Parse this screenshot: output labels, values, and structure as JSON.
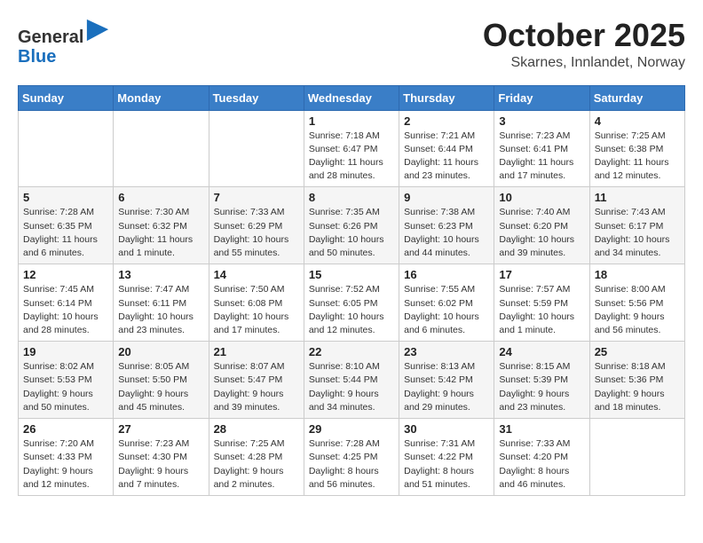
{
  "header": {
    "logo_line1": "General",
    "logo_line2": "Blue",
    "month": "October 2025",
    "location": "Skarnes, Innlandet, Norway"
  },
  "weekdays": [
    "Sunday",
    "Monday",
    "Tuesday",
    "Wednesday",
    "Thursday",
    "Friday",
    "Saturday"
  ],
  "weeks": [
    [
      {
        "day": "",
        "detail": ""
      },
      {
        "day": "",
        "detail": ""
      },
      {
        "day": "",
        "detail": ""
      },
      {
        "day": "1",
        "detail": "Sunrise: 7:18 AM\nSunset: 6:47 PM\nDaylight: 11 hours\nand 28 minutes."
      },
      {
        "day": "2",
        "detail": "Sunrise: 7:21 AM\nSunset: 6:44 PM\nDaylight: 11 hours\nand 23 minutes."
      },
      {
        "day": "3",
        "detail": "Sunrise: 7:23 AM\nSunset: 6:41 PM\nDaylight: 11 hours\nand 17 minutes."
      },
      {
        "day": "4",
        "detail": "Sunrise: 7:25 AM\nSunset: 6:38 PM\nDaylight: 11 hours\nand 12 minutes."
      }
    ],
    [
      {
        "day": "5",
        "detail": "Sunrise: 7:28 AM\nSunset: 6:35 PM\nDaylight: 11 hours\nand 6 minutes."
      },
      {
        "day": "6",
        "detail": "Sunrise: 7:30 AM\nSunset: 6:32 PM\nDaylight: 11 hours\nand 1 minute."
      },
      {
        "day": "7",
        "detail": "Sunrise: 7:33 AM\nSunset: 6:29 PM\nDaylight: 10 hours\nand 55 minutes."
      },
      {
        "day": "8",
        "detail": "Sunrise: 7:35 AM\nSunset: 6:26 PM\nDaylight: 10 hours\nand 50 minutes."
      },
      {
        "day": "9",
        "detail": "Sunrise: 7:38 AM\nSunset: 6:23 PM\nDaylight: 10 hours\nand 44 minutes."
      },
      {
        "day": "10",
        "detail": "Sunrise: 7:40 AM\nSunset: 6:20 PM\nDaylight: 10 hours\nand 39 minutes."
      },
      {
        "day": "11",
        "detail": "Sunrise: 7:43 AM\nSunset: 6:17 PM\nDaylight: 10 hours\nand 34 minutes."
      }
    ],
    [
      {
        "day": "12",
        "detail": "Sunrise: 7:45 AM\nSunset: 6:14 PM\nDaylight: 10 hours\nand 28 minutes."
      },
      {
        "day": "13",
        "detail": "Sunrise: 7:47 AM\nSunset: 6:11 PM\nDaylight: 10 hours\nand 23 minutes."
      },
      {
        "day": "14",
        "detail": "Sunrise: 7:50 AM\nSunset: 6:08 PM\nDaylight: 10 hours\nand 17 minutes."
      },
      {
        "day": "15",
        "detail": "Sunrise: 7:52 AM\nSunset: 6:05 PM\nDaylight: 10 hours\nand 12 minutes."
      },
      {
        "day": "16",
        "detail": "Sunrise: 7:55 AM\nSunset: 6:02 PM\nDaylight: 10 hours\nand 6 minutes."
      },
      {
        "day": "17",
        "detail": "Sunrise: 7:57 AM\nSunset: 5:59 PM\nDaylight: 10 hours\nand 1 minute."
      },
      {
        "day": "18",
        "detail": "Sunrise: 8:00 AM\nSunset: 5:56 PM\nDaylight: 9 hours\nand 56 minutes."
      }
    ],
    [
      {
        "day": "19",
        "detail": "Sunrise: 8:02 AM\nSunset: 5:53 PM\nDaylight: 9 hours\nand 50 minutes."
      },
      {
        "day": "20",
        "detail": "Sunrise: 8:05 AM\nSunset: 5:50 PM\nDaylight: 9 hours\nand 45 minutes."
      },
      {
        "day": "21",
        "detail": "Sunrise: 8:07 AM\nSunset: 5:47 PM\nDaylight: 9 hours\nand 39 minutes."
      },
      {
        "day": "22",
        "detail": "Sunrise: 8:10 AM\nSunset: 5:44 PM\nDaylight: 9 hours\nand 34 minutes."
      },
      {
        "day": "23",
        "detail": "Sunrise: 8:13 AM\nSunset: 5:42 PM\nDaylight: 9 hours\nand 29 minutes."
      },
      {
        "day": "24",
        "detail": "Sunrise: 8:15 AM\nSunset: 5:39 PM\nDaylight: 9 hours\nand 23 minutes."
      },
      {
        "day": "25",
        "detail": "Sunrise: 8:18 AM\nSunset: 5:36 PM\nDaylight: 9 hours\nand 18 minutes."
      }
    ],
    [
      {
        "day": "26",
        "detail": "Sunrise: 7:20 AM\nSunset: 4:33 PM\nDaylight: 9 hours\nand 12 minutes."
      },
      {
        "day": "27",
        "detail": "Sunrise: 7:23 AM\nSunset: 4:30 PM\nDaylight: 9 hours\nand 7 minutes."
      },
      {
        "day": "28",
        "detail": "Sunrise: 7:25 AM\nSunset: 4:28 PM\nDaylight: 9 hours\nand 2 minutes."
      },
      {
        "day": "29",
        "detail": "Sunrise: 7:28 AM\nSunset: 4:25 PM\nDaylight: 8 hours\nand 56 minutes."
      },
      {
        "day": "30",
        "detail": "Sunrise: 7:31 AM\nSunset: 4:22 PM\nDaylight: 8 hours\nand 51 minutes."
      },
      {
        "day": "31",
        "detail": "Sunrise: 7:33 AM\nSunset: 4:20 PM\nDaylight: 8 hours\nand 46 minutes."
      },
      {
        "day": "",
        "detail": ""
      }
    ]
  ]
}
